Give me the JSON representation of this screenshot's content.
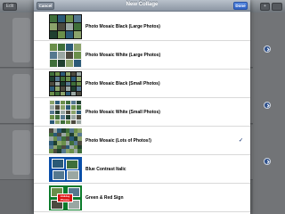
{
  "background_app": {
    "left_button": "Edit"
  },
  "modal": {
    "title": "New Collage",
    "cancel_label": "Cancel",
    "done_label": "Done"
  },
  "layouts": [
    {
      "label": "Photo Mosaic Black (Large Photos)",
      "selected": false
    },
    {
      "label": "Photo Mosaic White (Large Photos)",
      "selected": false
    },
    {
      "label": "Photo Mosaic Black (Small Photos)",
      "selected": false
    },
    {
      "label": "Photo Mosaic White (Small Photos)",
      "selected": false
    },
    {
      "label": "Photo Mosaic (Lots of Photos!)",
      "selected": true
    },
    {
      "label": "Blue Contrast Italic",
      "selected": false
    },
    {
      "label": "Green & Red Sign",
      "selected": false
    }
  ],
  "checkmark": "✓",
  "thumb_text": {
    "holiday": "Holiday",
    "photos": "Photos"
  },
  "colors": {
    "nav_gradient_top": "#b9c1cb",
    "done_blue": "#2f62c5",
    "check_blue": "#3a5288",
    "blue_theme": "#0a4fa8",
    "green_theme": "#0a7a2a",
    "sign_red": "#dd1111"
  }
}
